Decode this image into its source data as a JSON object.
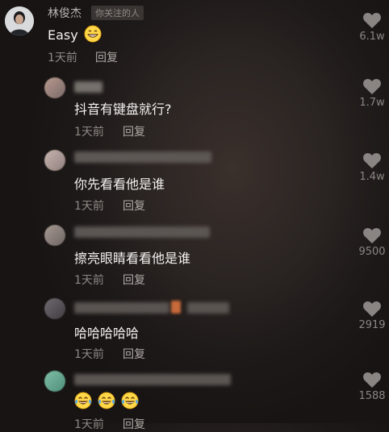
{
  "comments": [
    {
      "author": "林俊杰",
      "badge": "你关注的人",
      "text": "Easy",
      "time": "1天前",
      "reply": "回复",
      "likes": "6.1w"
    },
    {
      "text": "抖音有键盘就行?",
      "time": "1天前",
      "reply": "回复",
      "likes": "1.7w"
    },
    {
      "text": "你先看看他是谁",
      "time": "1天前",
      "reply": "回复",
      "likes": "1.4w"
    },
    {
      "text": "擦亮眼睛看看他是谁",
      "time": "1天前",
      "reply": "回复",
      "likes": "9500"
    },
    {
      "text": "哈哈哈哈哈",
      "time": "1天前",
      "reply": "回复",
      "likes": "2919"
    },
    {
      "text": "",
      "time": "1天前",
      "reply": "回复",
      "likes": "1588"
    }
  ],
  "icons": {
    "like": "heart-icon",
    "grin": "grinning-emoji",
    "laugh": "tears-of-joy-emoji"
  }
}
